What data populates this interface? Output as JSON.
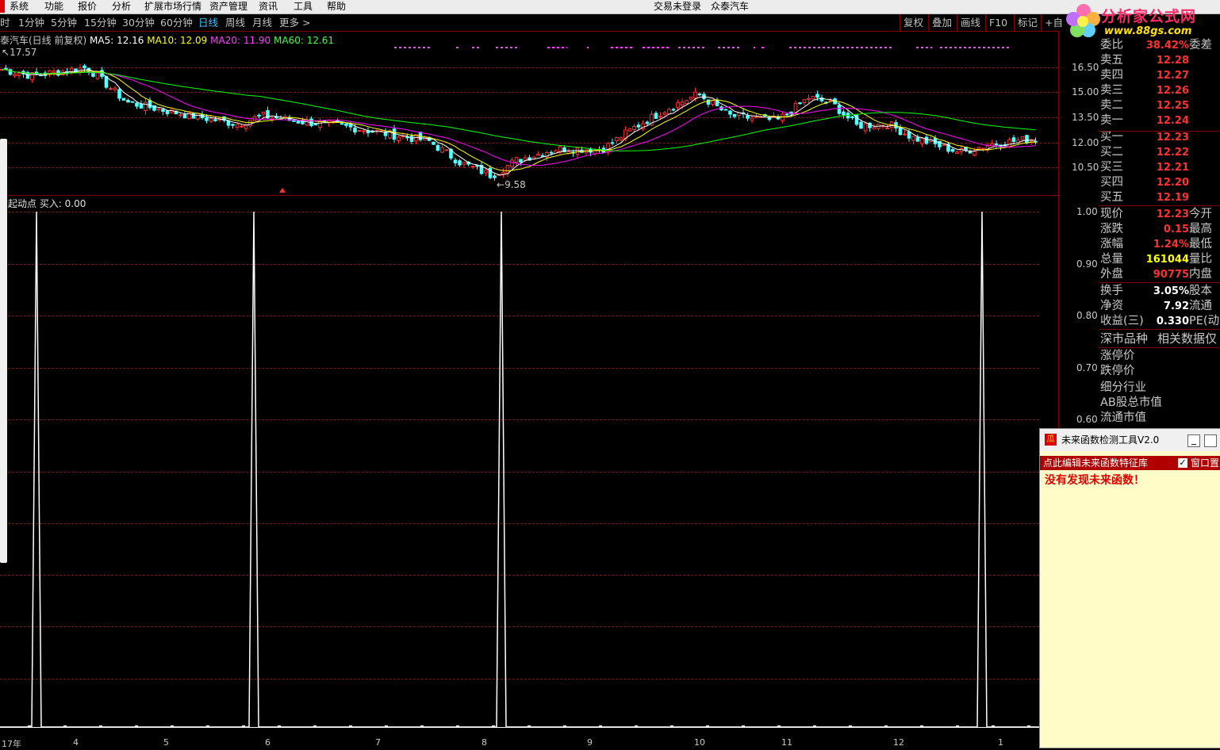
{
  "menu": [
    "系统",
    "功能",
    "报价",
    "分析",
    "扩展市场行情",
    "资产管理",
    "资讯",
    "工具",
    "帮助"
  ],
  "title_bar": {
    "login": "交易未登录",
    "stock": "众泰汽车"
  },
  "periods": [
    "时",
    "1分钟",
    "5分钟",
    "15分钟",
    "30分钟",
    "60分钟",
    "日线",
    "周线",
    "月线",
    "更多 >"
  ],
  "active_period": "日线",
  "toolbar": [
    "复权",
    "叠加",
    "画线",
    "F10",
    "标记",
    "+自"
  ],
  "chart_info": {
    "title": "泰汽车(日线 前复权)",
    "ma5": "MA5: 12.16",
    "ma10": "MA10: 12.09",
    "ma20": "MA20: 11.90",
    "ma60": "MA60: 12.61",
    "high_mark": "17.57",
    "low_mark": "9.58"
  },
  "indicator_label": "起动点  买入: 0.00",
  "colors": {
    "ma5": "#ffffff",
    "ma10": "#ffff00",
    "ma20": "#ff00ff",
    "ma60": "#00ff00",
    "up": "#ff3232",
    "down": "#54ffff",
    "grid": "#7a1a1a"
  },
  "y_axis_top": [
    "16.50",
    "15.00",
    "13.50",
    "12.00",
    "10.50"
  ],
  "y_axis_bottom": [
    "1.00",
    "0.90",
    "0.80",
    "0.70",
    "0.60"
  ],
  "x_axis": [
    "17年",
    "4",
    "5",
    "6",
    "7",
    "8",
    "9",
    "10",
    "11",
    "12",
    "1"
  ],
  "order_book": {
    "header": {
      "label": "委比",
      "value": "38.42%",
      "label2": "委差"
    },
    "asks": [
      {
        "label": "卖五",
        "price": "12.28"
      },
      {
        "label": "卖四",
        "price": "12.27"
      },
      {
        "label": "卖三",
        "price": "12.26"
      },
      {
        "label": "卖二",
        "price": "12.25"
      },
      {
        "label": "卖一",
        "price": "12.24"
      }
    ],
    "bids": [
      {
        "label": "买一",
        "price": "12.23"
      },
      {
        "label": "买二",
        "price": "12.22"
      },
      {
        "label": "买三",
        "price": "12.21"
      },
      {
        "label": "买四",
        "price": "12.20"
      },
      {
        "label": "买五",
        "price": "12.19"
      }
    ]
  },
  "quote": [
    {
      "label": "现价",
      "value": "12.23",
      "label2": "今开",
      "color": "#ff3232"
    },
    {
      "label": "涨跌",
      "value": "0.15",
      "label2": "最高",
      "color": "#ff3232"
    },
    {
      "label": "涨幅",
      "value": "1.24%",
      "label2": "最低",
      "color": "#ff3232"
    },
    {
      "label": "总量",
      "value": "161044",
      "label2": "量比",
      "color": "#ffff00"
    },
    {
      "label": "外盘",
      "value": "90775",
      "label2": "内盘",
      "color": "#ff3232"
    }
  ],
  "fundamentals": [
    {
      "label": "换手",
      "value": "3.05%",
      "label2": "股本"
    },
    {
      "label": "净资",
      "value": "7.92",
      "label2": "流通"
    },
    {
      "label": "收益(三)",
      "value": "0.330",
      "label2": "PE(动)"
    }
  ],
  "market_tabs": {
    "left": "深市品种",
    "right": "相关数据仅"
  },
  "extra_rows": [
    "涨停价",
    "跌停价",
    "细分行业",
    "AB股总市值",
    "流通市值"
  ],
  "tool_window": {
    "title": "未来函数检测工具V2.0",
    "edit_link": "点此编辑未来函数特征库",
    "pin_label": "窗口置",
    "message": "没有发现未来函数！"
  },
  "logo": {
    "name": "分析家公式网",
    "url": "www.88gs.com"
  },
  "chart_data": {
    "type": "line",
    "title": "起动点",
    "x": [
      "17年",
      "4",
      "5",
      "6",
      "7",
      "8",
      "9",
      "10",
      "11",
      "12",
      "1"
    ],
    "ylim": [
      0,
      1
    ],
    "signal_spikes_at_month_label": [
      "17年",
      "5",
      "8",
      "1"
    ],
    "series": [
      {
        "name": "起动点",
        "values": [
          0,
          1,
          0,
          0,
          1,
          0,
          0,
          1,
          0,
          0,
          1,
          0
        ]
      }
    ]
  }
}
